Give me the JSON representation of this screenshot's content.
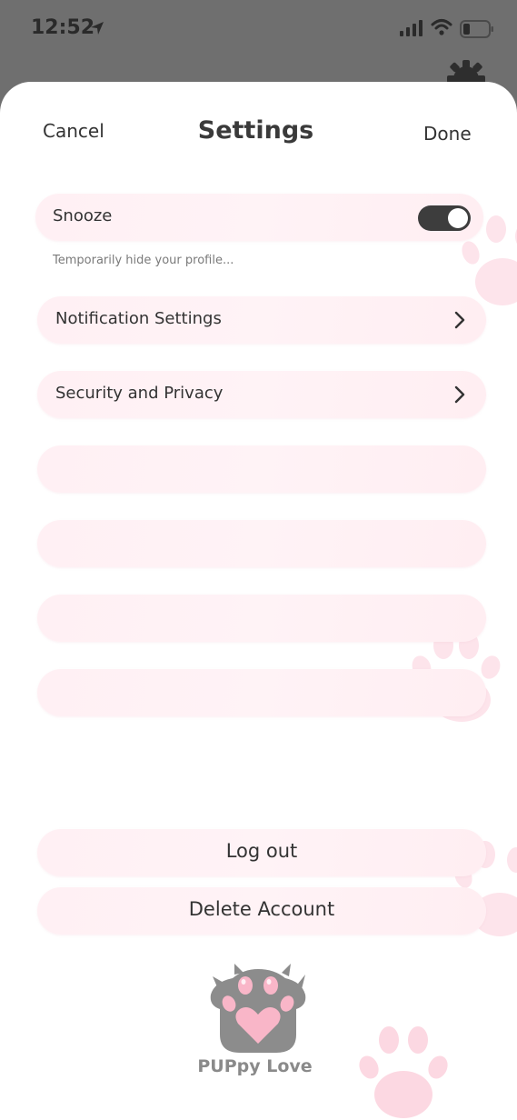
{
  "status_bar": {
    "time": "12:52",
    "icons": [
      "location-arrow-icon",
      "cellular-signal-icon",
      "wifi-icon",
      "battery-icon"
    ]
  },
  "header": {
    "cancel_label": "Cancel",
    "title": "Settings",
    "done_label": "Done"
  },
  "snooze": {
    "label": "Snooze",
    "enabled": true,
    "hint": "Temporarily hide your profile..."
  },
  "menu": {
    "items": [
      {
        "label": "Notification Settings",
        "icon": "chevron-right-icon"
      },
      {
        "label": "Security and Privacy",
        "icon": "chevron-right-icon"
      },
      {
        "label": ""
      },
      {
        "label": ""
      },
      {
        "label": ""
      },
      {
        "label": ""
      }
    ]
  },
  "account": {
    "logout_label": "Log out",
    "delete_label": "Delete Account"
  },
  "brand": {
    "name": "PUPpy Love",
    "icon": "paw-heart-logo-icon"
  },
  "colors": {
    "row_background": "#fff1f5",
    "paw_pink": "#fcdde6",
    "toggle_on": "#3d3d3d",
    "text": "#333333"
  }
}
